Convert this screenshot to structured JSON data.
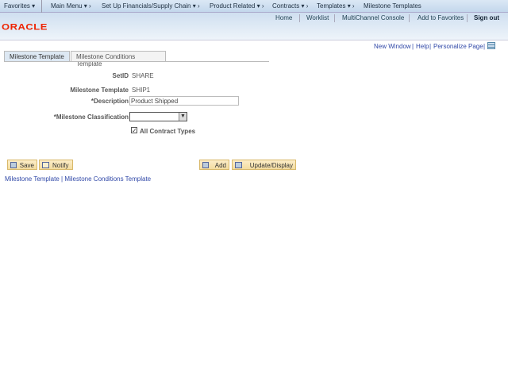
{
  "nav": {
    "favorites": "Favorites",
    "main_menu": "Main Menu",
    "crumbs": [
      "Set Up Financials/Supply Chain",
      "Product Related",
      "Contracts",
      "Templates",
      "Milestone Templates"
    ]
  },
  "header": {
    "links": [
      "Home",
      "Worklist",
      "MultiChannel Console",
      "Add to Favorites"
    ],
    "sign_out": "Sign out",
    "logo": "ORACLE"
  },
  "page_links": {
    "new_window": "New Window",
    "help": "Help",
    "personalize": "Personalize Page"
  },
  "tabs": [
    {
      "label": "Milestone Template",
      "active": true
    },
    {
      "label": "Milestone Conditions Template",
      "active": false
    }
  ],
  "form": {
    "setid_label": "SetID",
    "setid_value": "SHARE",
    "template_label": "Milestone Template",
    "template_value": "SHIP1",
    "description_label": "*Description",
    "description_value": "Product Shipped",
    "classification_label": "*Milestone Classification",
    "classification_value": "",
    "all_contract_types_label": "All Contract Types",
    "all_contract_types_checked": true
  },
  "buttons": {
    "save": "Save",
    "notify": "Notify",
    "add": "Add",
    "update": "Update/Display"
  },
  "footer_links": [
    "Milestone Template",
    "Milestone Conditions Template"
  ],
  "colors": {
    "brand": "#e22200",
    "link": "#3149a8",
    "button": "#f3dca0"
  }
}
